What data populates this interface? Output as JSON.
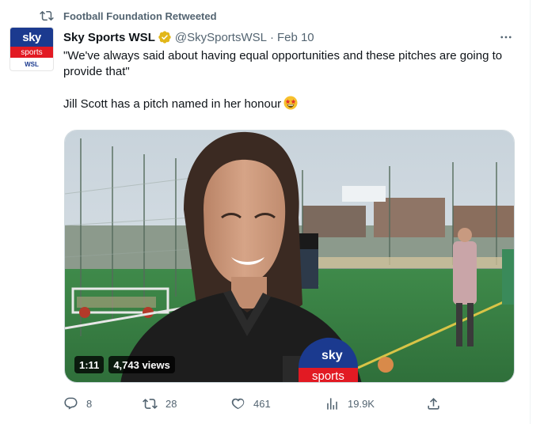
{
  "retweet": {
    "label": "Football Foundation Retweeted"
  },
  "author": {
    "display_name": "Sky Sports WSL",
    "handle": "@SkySportsWSL",
    "separator": "·",
    "date": "Feb 10",
    "avatar": {
      "line1": "sky",
      "line2": "sports",
      "line3": "WSL"
    }
  },
  "tweet": {
    "line1": "\"We've always said about having equal opportunities and these pitches are going to provide that\"",
    "line2": "Jill Scott has a pitch named in her honour"
  },
  "media": {
    "duration": "1:11",
    "views": "4,743 views",
    "mic_logo_top": "sky",
    "mic_logo_bottom": "sports"
  },
  "actions": {
    "replies": "8",
    "retweets": "28",
    "likes": "461",
    "views": "19.9K"
  },
  "colors": {
    "text_primary": "#0f1419",
    "text_secondary": "#536471",
    "verified_gold": "#e2b719",
    "sky_blue": "#1b3a8f",
    "sky_red": "#e21a23"
  }
}
